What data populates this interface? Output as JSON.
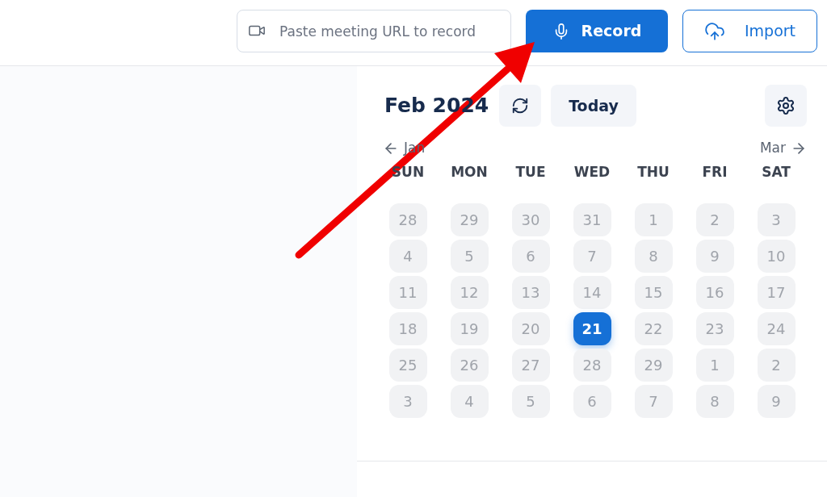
{
  "toolbar": {
    "url_field": {
      "placeholder": "Paste meeting URL to record"
    },
    "record_button": "Record",
    "import_button": "Import"
  },
  "calendar": {
    "title": "Feb 2024",
    "today_button": "Today",
    "prev_month": "Jan",
    "next_month": "Mar",
    "weekdays": [
      "SUN",
      "MON",
      "TUE",
      "WED",
      "THU",
      "FRI",
      "SAT"
    ],
    "weeks": [
      [
        {
          "day": "28",
          "selected": false
        },
        {
          "day": "29",
          "selected": false
        },
        {
          "day": "30",
          "selected": false
        },
        {
          "day": "31",
          "selected": false
        },
        {
          "day": "1",
          "selected": false
        },
        {
          "day": "2",
          "selected": false
        },
        {
          "day": "3",
          "selected": false
        }
      ],
      [
        {
          "day": "4",
          "selected": false
        },
        {
          "day": "5",
          "selected": false
        },
        {
          "day": "6",
          "selected": false
        },
        {
          "day": "7",
          "selected": false
        },
        {
          "day": "8",
          "selected": false
        },
        {
          "day": "9",
          "selected": false
        },
        {
          "day": "10",
          "selected": false
        }
      ],
      [
        {
          "day": "11",
          "selected": false
        },
        {
          "day": "12",
          "selected": false
        },
        {
          "day": "13",
          "selected": false
        },
        {
          "day": "14",
          "selected": false
        },
        {
          "day": "15",
          "selected": false
        },
        {
          "day": "16",
          "selected": false
        },
        {
          "day": "17",
          "selected": false
        }
      ],
      [
        {
          "day": "18",
          "selected": false
        },
        {
          "day": "19",
          "selected": false
        },
        {
          "day": "20",
          "selected": false
        },
        {
          "day": "21",
          "selected": true
        },
        {
          "day": "22",
          "selected": false
        },
        {
          "day": "23",
          "selected": false
        },
        {
          "day": "24",
          "selected": false
        }
      ],
      [
        {
          "day": "25",
          "selected": false
        },
        {
          "day": "26",
          "selected": false
        },
        {
          "day": "27",
          "selected": false
        },
        {
          "day": "28",
          "selected": false
        },
        {
          "day": "29",
          "selected": false
        },
        {
          "day": "1",
          "selected": false
        },
        {
          "day": "2",
          "selected": false
        }
      ],
      [
        {
          "day": "3",
          "selected": false
        },
        {
          "day": "4",
          "selected": false
        },
        {
          "day": "5",
          "selected": false
        },
        {
          "day": "6",
          "selected": false
        },
        {
          "day": "7",
          "selected": false
        },
        {
          "day": "8",
          "selected": false
        },
        {
          "day": "9",
          "selected": false
        }
      ]
    ]
  }
}
